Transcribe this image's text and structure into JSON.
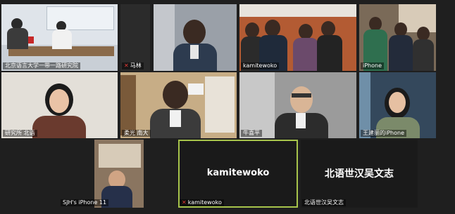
{
  "colors": {
    "background": "#1f1f1f",
    "active_speaker_border": "#a7c44b",
    "muted_icon": "#e53935"
  },
  "participants": [
    {
      "name": "北京语言大学一带一路研究院",
      "muted": false,
      "banner_text": "一带一路研究院"
    },
    {
      "name": "马林",
      "muted": true
    },
    {
      "name": "kamitewoko",
      "muted": false
    },
    {
      "name": "iPhone",
      "muted": false
    },
    {
      "name": "研究所 北语",
      "muted": false
    },
    {
      "name": "柔光 南大",
      "muted": false
    },
    {
      "name": "牛喜平",
      "muted": false
    },
    {
      "name": "王建丽的iPhone",
      "muted": false
    },
    {
      "name": "SJH's iPhone 11",
      "muted": false
    },
    {
      "name": "kamitewoko",
      "muted": true,
      "display_text": "kamitewoko",
      "active": true
    },
    {
      "name": "北语世汉吴文志",
      "muted": false,
      "display_text": "北语世汉吴文志"
    }
  ]
}
